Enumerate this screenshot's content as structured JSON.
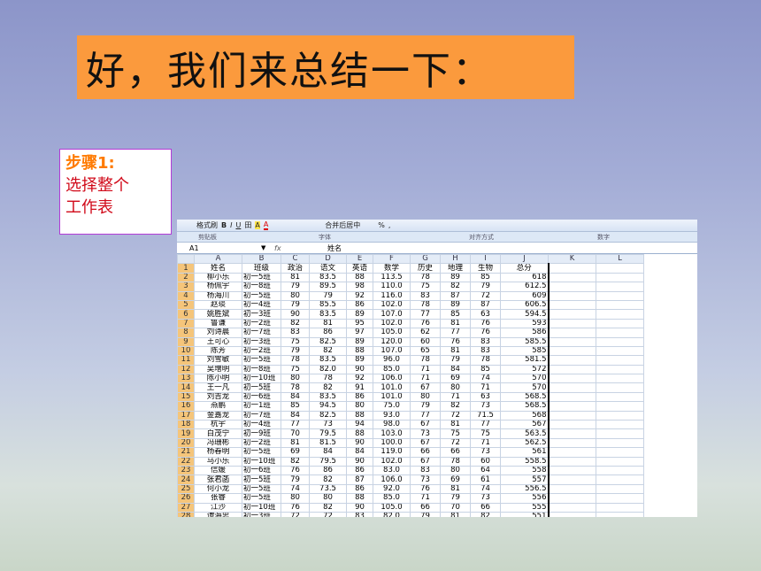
{
  "slide": {
    "title": "好，我们来总结一下：",
    "step_label": "步骤1:",
    "step_text_line1": "选择整个",
    "step_text_line2": "工作表"
  },
  "ribbon": {
    "items": [
      "格式刷",
      "B",
      "I",
      "U",
      "田",
      "A",
      "A",
      "合并后居中",
      "%",
      ","
    ],
    "groups": [
      "剪贴板",
      "字体",
      "对齐方式",
      "数字"
    ]
  },
  "formula_bar": {
    "name_box": "A1",
    "fx": "fx",
    "content": "姓名"
  },
  "sheet": {
    "columns": [
      "A",
      "B",
      "C",
      "D",
      "E",
      "F",
      "G",
      "H",
      "I",
      "J",
      "K",
      "L"
    ],
    "rows": [
      [
        "1",
        "姓名",
        "班级",
        "政治",
        "语文",
        "英语",
        "数学",
        "历史",
        "地理",
        "生物",
        "总分"
      ],
      [
        "2",
        "柳小乐",
        "初一5班",
        "81",
        "83.5",
        "88",
        "113.5",
        "78",
        "89",
        "85",
        "618"
      ],
      [
        "3",
        "杨佩宇",
        "初一8班",
        "79",
        "89.5",
        "98",
        "110.0",
        "75",
        "82",
        "79",
        "612.5"
      ],
      [
        "4",
        "杨海川",
        "初一5班",
        "80",
        "79",
        "92",
        "116.0",
        "83",
        "87",
        "72",
        "609"
      ],
      [
        "5",
        "赵琰",
        "初一4班",
        "79",
        "85.5",
        "86",
        "102.0",
        "78",
        "89",
        "87",
        "606.5"
      ],
      [
        "6",
        "姚胜斌",
        "初一3班",
        "90",
        "83.5",
        "89",
        "107.0",
        "77",
        "85",
        "63",
        "594.5"
      ],
      [
        "7",
        "鲁谦",
        "初一2班",
        "82",
        "81",
        "95",
        "102.0",
        "76",
        "81",
        "76",
        "593"
      ],
      [
        "8",
        "刘诗晨",
        "初一7班",
        "83",
        "86",
        "97",
        "105.0",
        "62",
        "77",
        "76",
        "586"
      ],
      [
        "9",
        "王可心",
        "初一3班",
        "75",
        "82.5",
        "89",
        "120.0",
        "60",
        "76",
        "83",
        "585.5"
      ],
      [
        "10",
        "陈芳",
        "初一2班",
        "79",
        "82",
        "88",
        "107.0",
        "65",
        "81",
        "83",
        "585"
      ],
      [
        "11",
        "刘雪敏",
        "初一5班",
        "78",
        "83.5",
        "89",
        "96.0",
        "78",
        "79",
        "78",
        "581.5"
      ],
      [
        "12",
        "吴增明",
        "初一8班",
        "75",
        "82.0",
        "90",
        "85.0",
        "71",
        "84",
        "85",
        "572"
      ],
      [
        "13",
        "陈小明",
        "初一10班",
        "80",
        "78",
        "92",
        "106.0",
        "71",
        "69",
        "74",
        "570"
      ],
      [
        "14",
        "王一凡",
        "初一5班",
        "78",
        "82",
        "91",
        "101.0",
        "67",
        "80",
        "71",
        "570"
      ],
      [
        "15",
        "刘吉龙",
        "初一6班",
        "84",
        "83.5",
        "86",
        "101.0",
        "80",
        "71",
        "63",
        "568.5"
      ],
      [
        "16",
        "燕鹏",
        "初一1班",
        "85",
        "94.5",
        "80",
        "75.0",
        "79",
        "82",
        "73",
        "568.5"
      ],
      [
        "17",
        "金嘉龙",
        "初一7班",
        "84",
        "82.5",
        "88",
        "93.0",
        "77",
        "72",
        "71.5",
        "568"
      ],
      [
        "18",
        "杭宇",
        "初一4班",
        "77",
        "73",
        "94",
        "98.0",
        "67",
        "81",
        "77",
        "567"
      ],
      [
        "19",
        "白茂宁",
        "初一9班",
        "70",
        "79.5",
        "88",
        "103.0",
        "73",
        "75",
        "75",
        "563.5"
      ],
      [
        "20",
        "冯珊彬",
        "初一2班",
        "81",
        "81.5",
        "90",
        "100.0",
        "67",
        "72",
        "71",
        "562.5"
      ],
      [
        "21",
        "杨春明",
        "初一5班",
        "69",
        "84",
        "84",
        "119.0",
        "66",
        "66",
        "73",
        "561"
      ],
      [
        "22",
        "马小乐",
        "初一10班",
        "82",
        "79.5",
        "90",
        "102.0",
        "67",
        "78",
        "60",
        "558.5"
      ],
      [
        "23",
        "信媛",
        "初一6班",
        "76",
        "86",
        "86",
        "83.0",
        "83",
        "80",
        "64",
        "558"
      ],
      [
        "24",
        "张君菡",
        "初一5班",
        "79",
        "82",
        "87",
        "106.0",
        "73",
        "69",
        "61",
        "557"
      ],
      [
        "25",
        "何小龙",
        "初一5班",
        "74",
        "73.5",
        "86",
        "92.0",
        "76",
        "81",
        "74",
        "556.5"
      ],
      [
        "26",
        "张睿",
        "初一5班",
        "80",
        "80",
        "88",
        "85.0",
        "71",
        "79",
        "73",
        "556"
      ],
      [
        "27",
        "江沙",
        "初一10班",
        "76",
        "82",
        "90",
        "105.0",
        "66",
        "70",
        "66",
        "555"
      ],
      [
        "28",
        "谭海忠",
        "初一3班",
        "72",
        "72",
        "83",
        "82.0",
        "79",
        "81",
        "82",
        "551"
      ]
    ]
  }
}
